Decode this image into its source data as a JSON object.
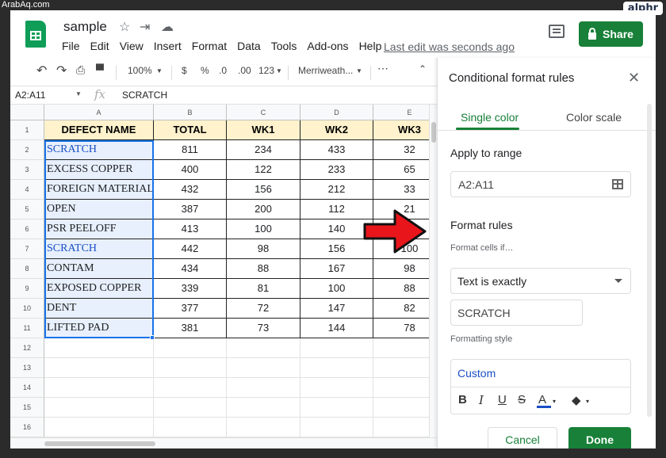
{
  "watermark": "ArabAq.com",
  "brand_badge": "alphr",
  "doc": {
    "title": "sample",
    "last_edit": "Last edit was seconds ago"
  },
  "menu": [
    "File",
    "Edit",
    "View",
    "Insert",
    "Format",
    "Data",
    "Tools",
    "Add-ons",
    "Help"
  ],
  "share_label": "Share",
  "toolbar": {
    "zoom": "100%",
    "currency": "$",
    "percent": "%",
    "dec_less": ".0",
    "dec_more": ".00",
    "more_formats": "123",
    "font": "Merriweath..."
  },
  "formula_bar": {
    "name_box": "A2:A11",
    "fx": "fx",
    "value": "SCRATCH"
  },
  "columns": [
    "A",
    "B",
    "C",
    "D",
    "E"
  ],
  "row_numbers": [
    "1",
    "2",
    "3",
    "4",
    "5",
    "6",
    "7",
    "8",
    "9",
    "10",
    "11",
    "12",
    "13",
    "14",
    "15",
    "16"
  ],
  "table": {
    "headers": [
      "DEFECT NAME",
      "TOTAL",
      "WK1",
      "WK2",
      "WK3"
    ],
    "rows": [
      {
        "name": "SCRATCH",
        "highlight": true,
        "total": "811",
        "wk1": "234",
        "wk2": "433",
        "wk3": "32"
      },
      {
        "name": "EXCESS COPPER",
        "highlight": false,
        "total": "400",
        "wk1": "122",
        "wk2": "233",
        "wk3": "65"
      },
      {
        "name": "FOREIGN MATERIAL",
        "highlight": false,
        "total": "432",
        "wk1": "156",
        "wk2": "212",
        "wk3": "33"
      },
      {
        "name": "OPEN",
        "highlight": false,
        "total": "387",
        "wk1": "200",
        "wk2": "112",
        "wk3": "21"
      },
      {
        "name": "PSR PEELOFF",
        "highlight": false,
        "total": "413",
        "wk1": "100",
        "wk2": "140",
        "wk3": ""
      },
      {
        "name": "SCRATCH",
        "highlight": true,
        "total": "442",
        "wk1": "98",
        "wk2": "156",
        "wk3": "100"
      },
      {
        "name": "CONTAM",
        "highlight": false,
        "total": "434",
        "wk1": "88",
        "wk2": "167",
        "wk3": "98"
      },
      {
        "name": "EXPOSED COPPER",
        "highlight": false,
        "total": "339",
        "wk1": "81",
        "wk2": "100",
        "wk3": "88"
      },
      {
        "name": "DENT",
        "highlight": false,
        "total": "377",
        "wk1": "72",
        "wk2": "147",
        "wk3": "82"
      },
      {
        "name": "LIFTED PAD",
        "highlight": false,
        "total": "381",
        "wk1": "73",
        "wk2": "144",
        "wk3": "78"
      }
    ]
  },
  "panel": {
    "title": "Conditional format rules",
    "tab_single": "Single color",
    "tab_scale": "Color scale",
    "apply_label": "Apply to range",
    "range": "A2:A11",
    "rules_label": "Format rules",
    "cells_if_label": "Format cells if…",
    "condition": "Text is exactly",
    "value": "SCRATCH",
    "style_label": "Formatting style",
    "style_name": "Custom",
    "bold": "B",
    "italic": "I",
    "underline": "U",
    "strike": "S",
    "text_color": "A",
    "cancel": "Cancel",
    "done": "Done"
  },
  "colors": {
    "accent": "#188038",
    "header_fill": "#fff2cc",
    "selection": "#e7f0fc",
    "highlight_text": "#1a4ec5",
    "arrow": "#e8161b"
  }
}
